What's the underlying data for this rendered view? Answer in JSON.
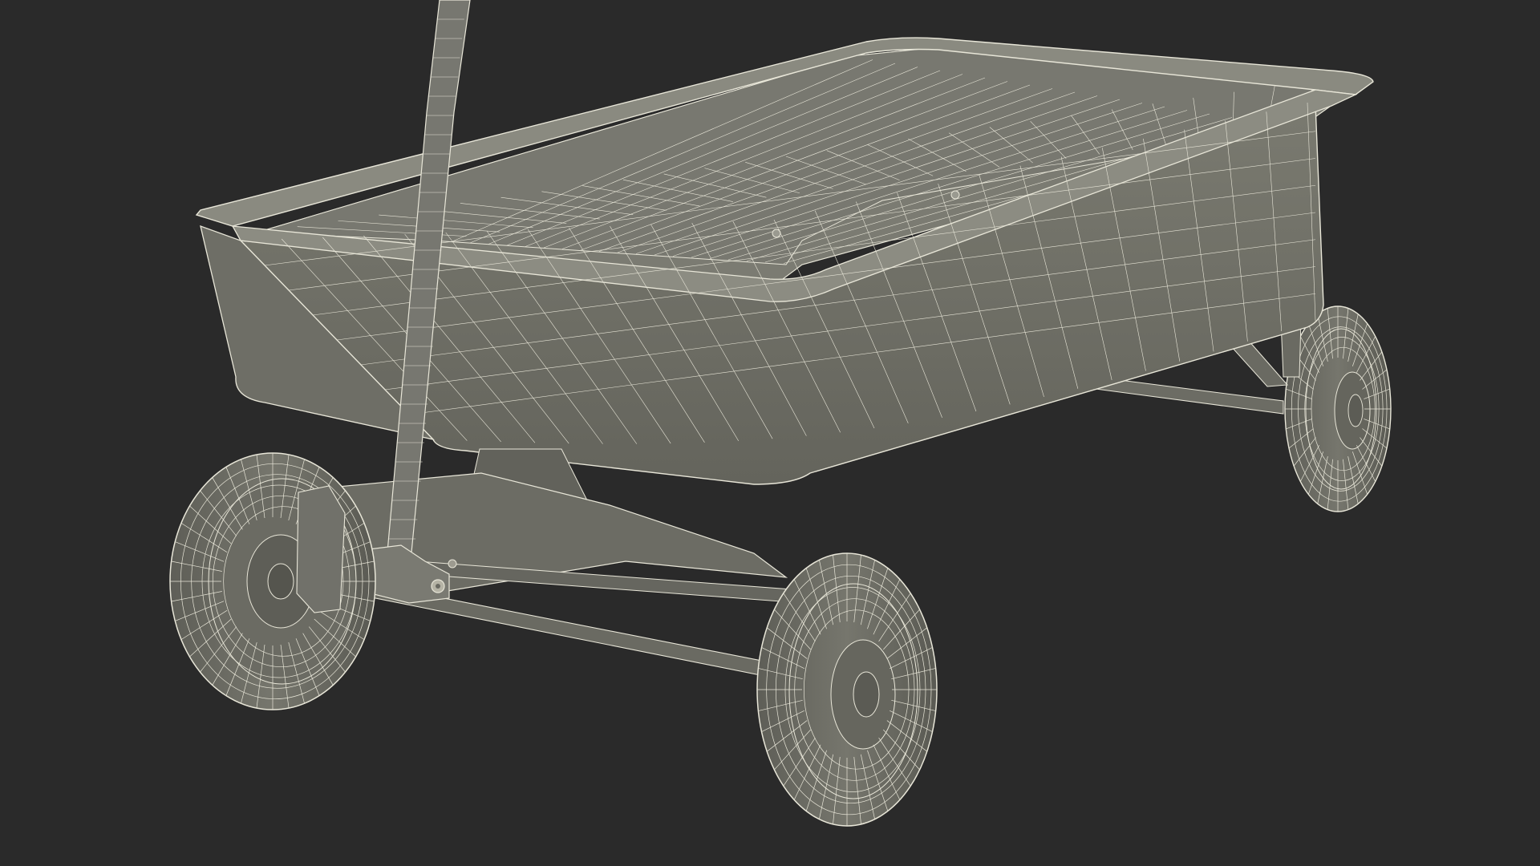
{
  "scene": {
    "subject": "wireframe-wagon",
    "colors": {
      "background": "#2a2a2a",
      "surface": "#6f6f66",
      "surface_light": "#8a8a80",
      "surface_dark": "#55554d",
      "wire": "#e8e6d8",
      "shadow": "#4a4a44"
    }
  }
}
